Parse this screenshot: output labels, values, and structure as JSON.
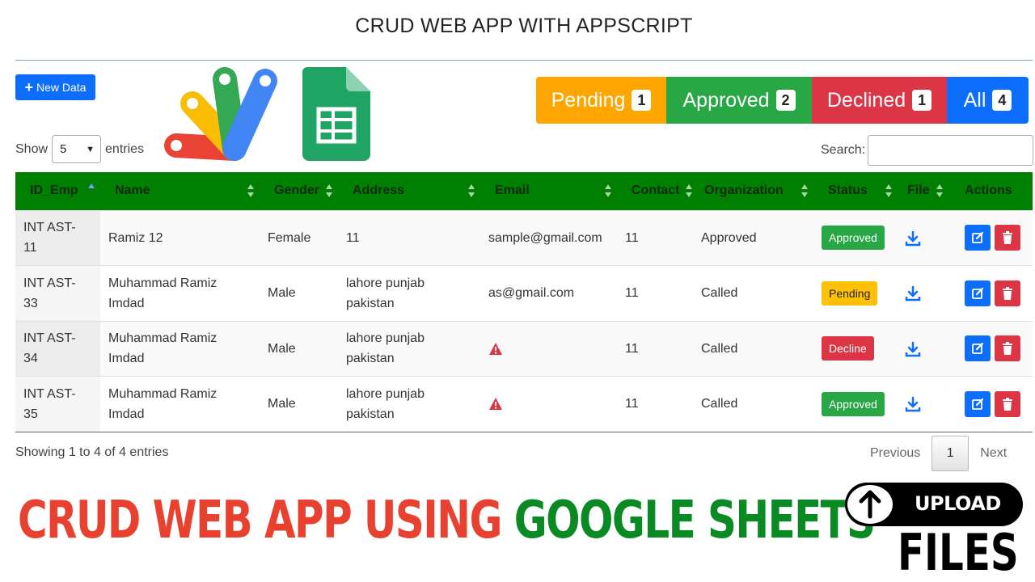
{
  "app": {
    "title": "CRUD WEB APP WITH APPSCRIPT"
  },
  "toolbar": {
    "new_label": "New Data"
  },
  "status_filters": [
    {
      "label": "Pending",
      "count": "1",
      "color": "#ffa500"
    },
    {
      "label": "Approved",
      "count": "2",
      "color": "#28a745"
    },
    {
      "label": "Declined",
      "count": "1",
      "color": "#dc3545"
    },
    {
      "label": "All",
      "count": "4",
      "color": "#0d6efd"
    }
  ],
  "length": {
    "show": "Show",
    "value": "5",
    "entries": "entries"
  },
  "search": {
    "label": "Search:",
    "value": ""
  },
  "table": {
    "header_color": "#008000",
    "columns": [
      "ID_Emp",
      "Name",
      "Gender",
      "Address",
      "Email",
      "Contact",
      "Organization",
      "Status",
      "File",
      "Actions"
    ],
    "rows": [
      {
        "id": "INT AST-11",
        "name": "Ramiz 12",
        "gender": "Female",
        "address": "11",
        "email": "sample@gmail.com",
        "email_missing": false,
        "contact": "11",
        "organization": "Approved",
        "status": "Approved"
      },
      {
        "id": "INT AST-33",
        "name": "Muhammad Ramiz Imdad",
        "gender": "Male",
        "address": "lahore punjab pakistan",
        "email": "as@gmail.com",
        "email_missing": false,
        "contact": "11",
        "organization": "Called",
        "status": "Pending"
      },
      {
        "id": "INT AST-34",
        "name": "Muhammad Ramiz Imdad",
        "gender": "Male",
        "address": "lahore punjab pakistan",
        "email": "",
        "email_missing": true,
        "contact": "11",
        "organization": "Called",
        "status": "Decline"
      },
      {
        "id": "INT AST-35",
        "name": "Muhammad Ramiz Imdad",
        "gender": "Male",
        "address": "lahore punjab pakistan",
        "email": "",
        "email_missing": true,
        "contact": "11",
        "organization": "Called",
        "status": "Approved"
      }
    ]
  },
  "footer": {
    "info": "Showing 1 to 4 of 4 entries",
    "previous": "Previous",
    "page": "1",
    "next": "Next"
  },
  "banner": {
    "part1": "CRUD WEB APP USING",
    "part2": "GOOGLE SHEETS",
    "upload": "UPLOAD",
    "files": "FILES"
  }
}
